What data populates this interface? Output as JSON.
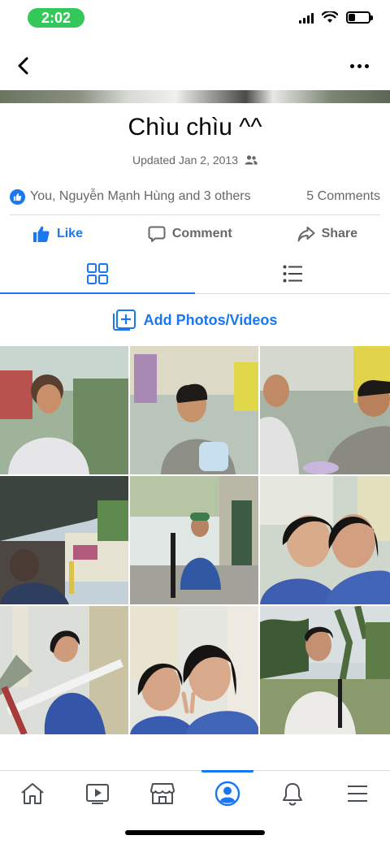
{
  "status_bar": {
    "time": "2:02",
    "battery_level": 0.35
  },
  "album": {
    "title": "Chìu chìu ^^",
    "updated": "Updated Jan 2, 2013"
  },
  "reactions": {
    "likers": "You, Nguyễn Mạnh Hùng and 3 others",
    "comments": "5 Comments"
  },
  "actions": {
    "like": "Like",
    "comment": "Comment",
    "share": "Share"
  },
  "add_media_label": "Add Photos/Videos",
  "photos": [
    {
      "name": "photo-boy-eating-at-cafe"
    },
    {
      "name": "photo-boy-with-kettle"
    },
    {
      "name": "photo-boys-at-table"
    },
    {
      "name": "photo-cafe-umbrella-street"
    },
    {
      "name": "photo-girl-waving-street"
    },
    {
      "name": "photo-two-girls-selfie"
    },
    {
      "name": "photo-girl-on-balcony"
    },
    {
      "name": "photo-two-girls-peace-sign"
    },
    {
      "name": "photo-man-in-white-shirt"
    }
  ],
  "tab_bar": [
    "home",
    "watch",
    "marketplace",
    "profile",
    "notifications",
    "menu"
  ],
  "colors": {
    "accent": "#1877f2",
    "secondary_text": "#65676b",
    "status_pill": "#34c759"
  }
}
